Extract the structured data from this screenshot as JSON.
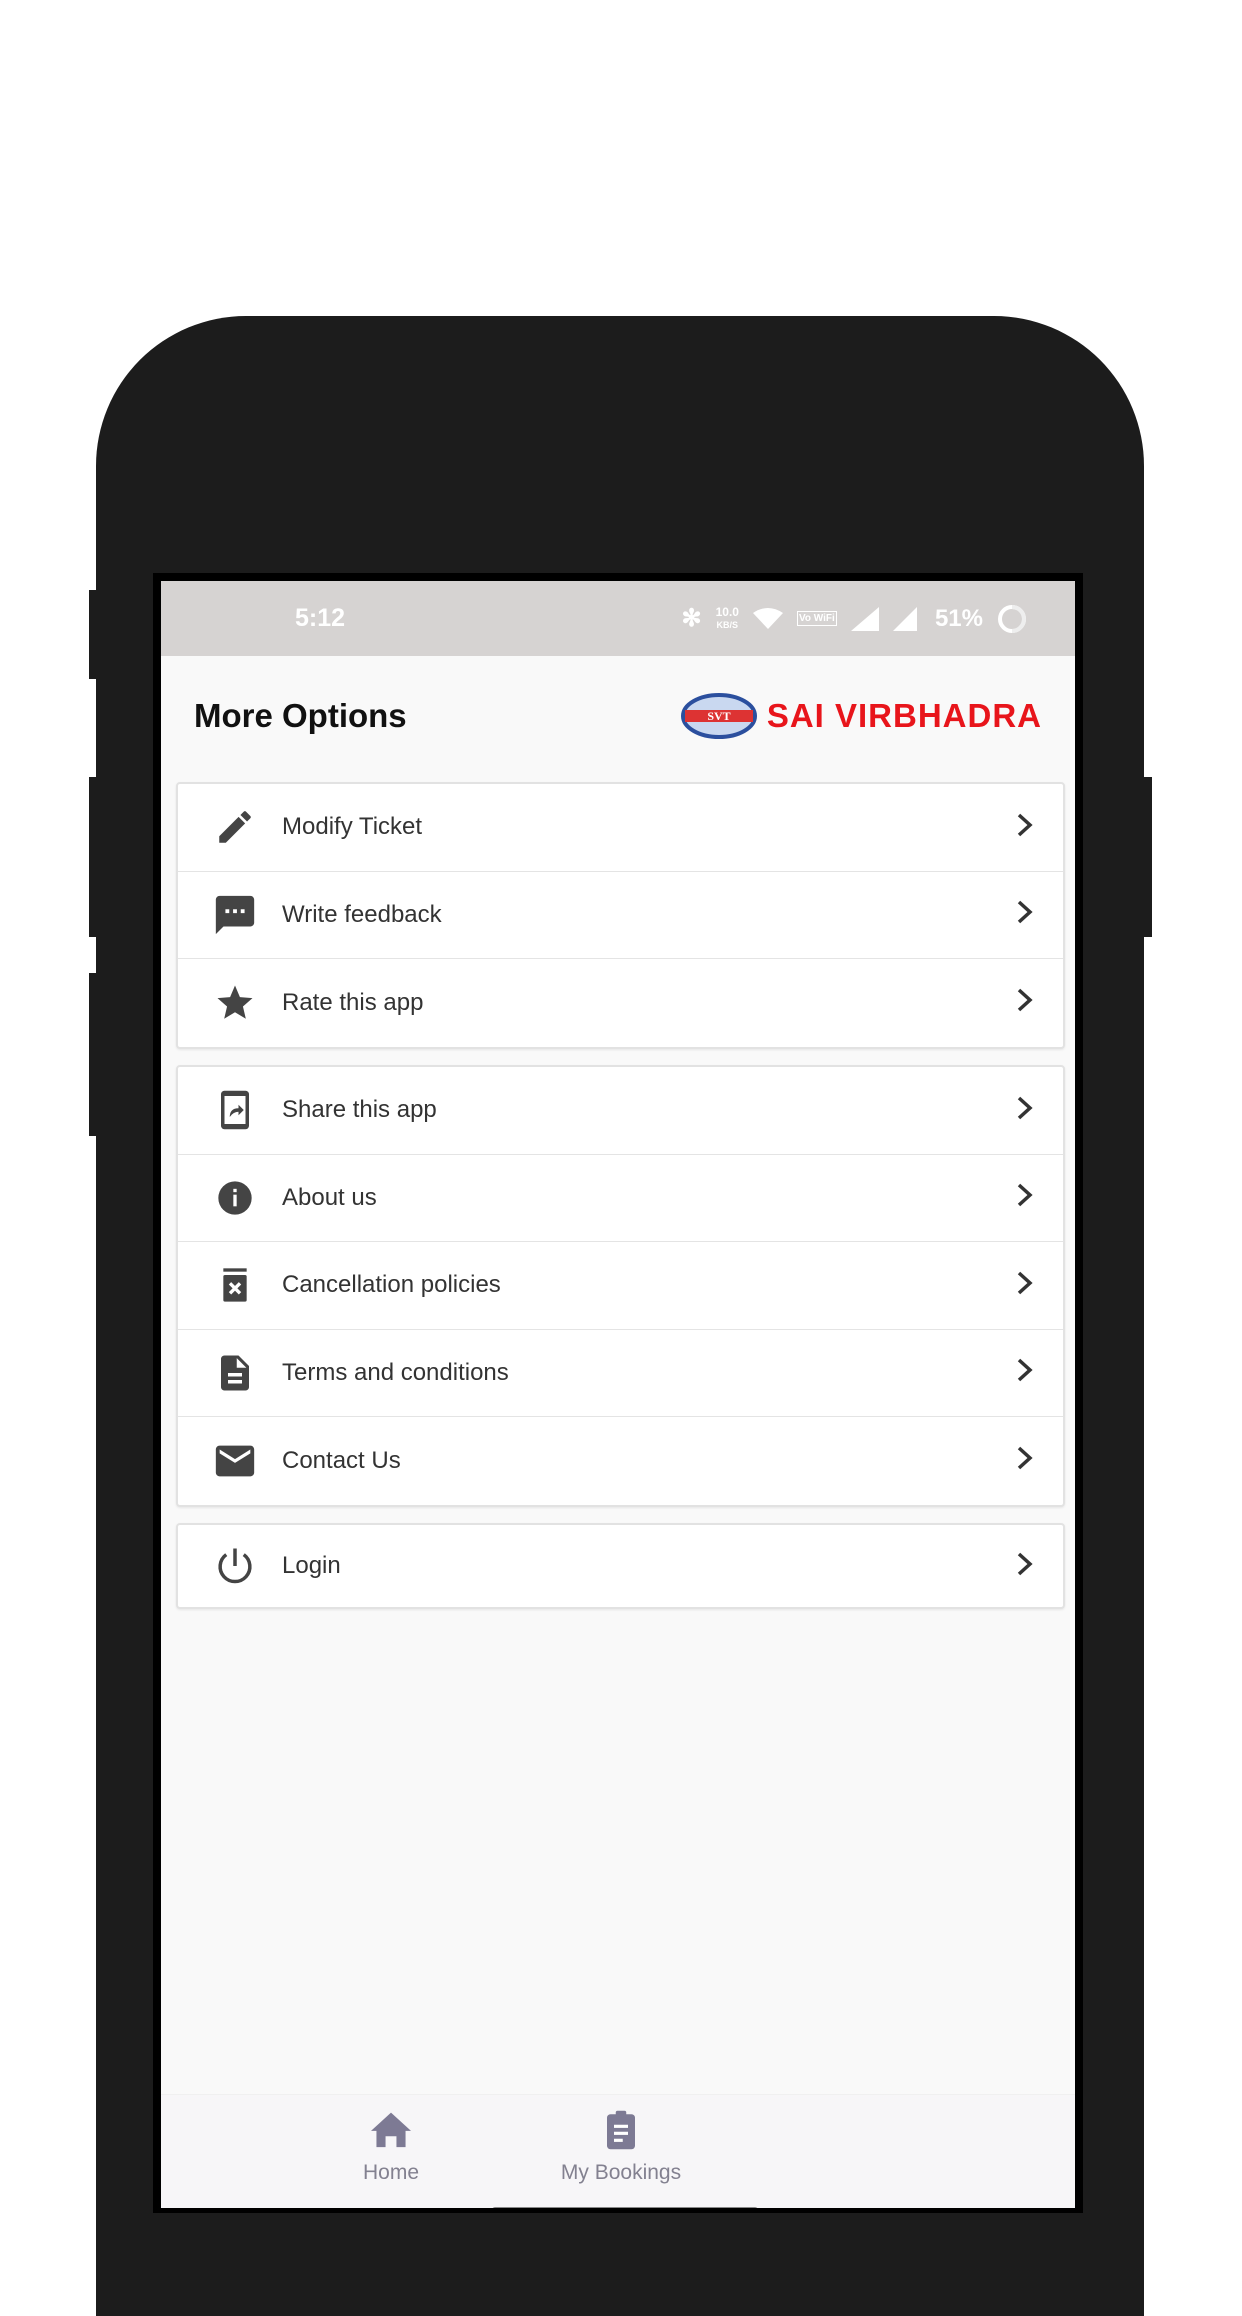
{
  "status_bar": {
    "time": "5:12",
    "net_speed": "10.0",
    "net_unit": "KB/S",
    "volte": "Vo WiFi",
    "battery": "51%"
  },
  "header": {
    "title": "More Options",
    "brand": "SAI VIRBHADRA",
    "logo_text": "SVT",
    "brand_color": "#e8151b"
  },
  "groups": [
    [
      {
        "label": "Modify Ticket",
        "icon": "pencil-icon"
      },
      {
        "label": "Write feedback",
        "icon": "feedback-icon"
      },
      {
        "label": "Rate this app",
        "icon": "star-icon"
      }
    ],
    [
      {
        "label": "Share this app",
        "icon": "share-icon"
      },
      {
        "label": "About us",
        "icon": "info-icon"
      },
      {
        "label": "Cancellation policies",
        "icon": "cancel-icon"
      },
      {
        "label": "Terms and conditions",
        "icon": "document-icon"
      },
      {
        "label": "Contact Us",
        "icon": "mail-icon"
      }
    ],
    [
      {
        "label": "Login",
        "icon": "power-icon"
      }
    ]
  ],
  "bottom_nav": [
    {
      "label": "Home",
      "icon": "home-icon"
    },
    {
      "label": "My Bookings",
      "icon": "clipboard-icon"
    }
  ],
  "nav_color": "#7d7a94"
}
